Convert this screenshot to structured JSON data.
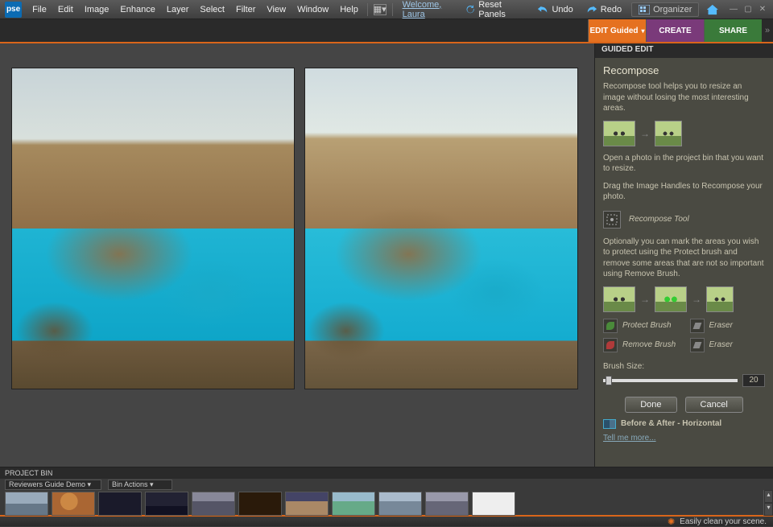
{
  "menu": {
    "items": [
      "File",
      "Edit",
      "Image",
      "Enhance",
      "Layer",
      "Select",
      "Filter",
      "View",
      "Window",
      "Help"
    ],
    "welcome": "Welcome, Laura",
    "reset": "Reset Panels",
    "undo": "Undo",
    "redo": "Redo",
    "organizer": "Organizer"
  },
  "modes": {
    "edit": "EDIT Guided",
    "create": "CREATE",
    "share": "SHARE"
  },
  "panel": {
    "header": "GUIDED EDIT",
    "title": "Recompose",
    "desc1": "Recompose tool helps you to resize an image without losing the most interesting areas.",
    "step1a": "Open a photo in the project bin that you want to resize.",
    "step1b": "Drag the Image Handles to Recompose your photo.",
    "tool_name": "Recompose Tool",
    "desc2": "Optionally you can mark the areas you wish to protect using the Protect brush and remove some areas that are not so important using Remove Brush.",
    "brushes": {
      "protect": "Protect Brush",
      "eraser1": "Eraser",
      "remove": "Remove Brush",
      "eraser2": "Eraser"
    },
    "brush_size_label": "Brush Size:",
    "brush_size_value": "20",
    "done": "Done",
    "cancel": "Cancel",
    "view_mode": "Before & After - Horizontal",
    "tell_more": "Tell me more..."
  },
  "bin": {
    "header": "PROJECT BIN",
    "select": "Reviewers Guide Demo",
    "actions": "Bin Actions"
  },
  "status": {
    "tip": "Easily clean your scene."
  }
}
